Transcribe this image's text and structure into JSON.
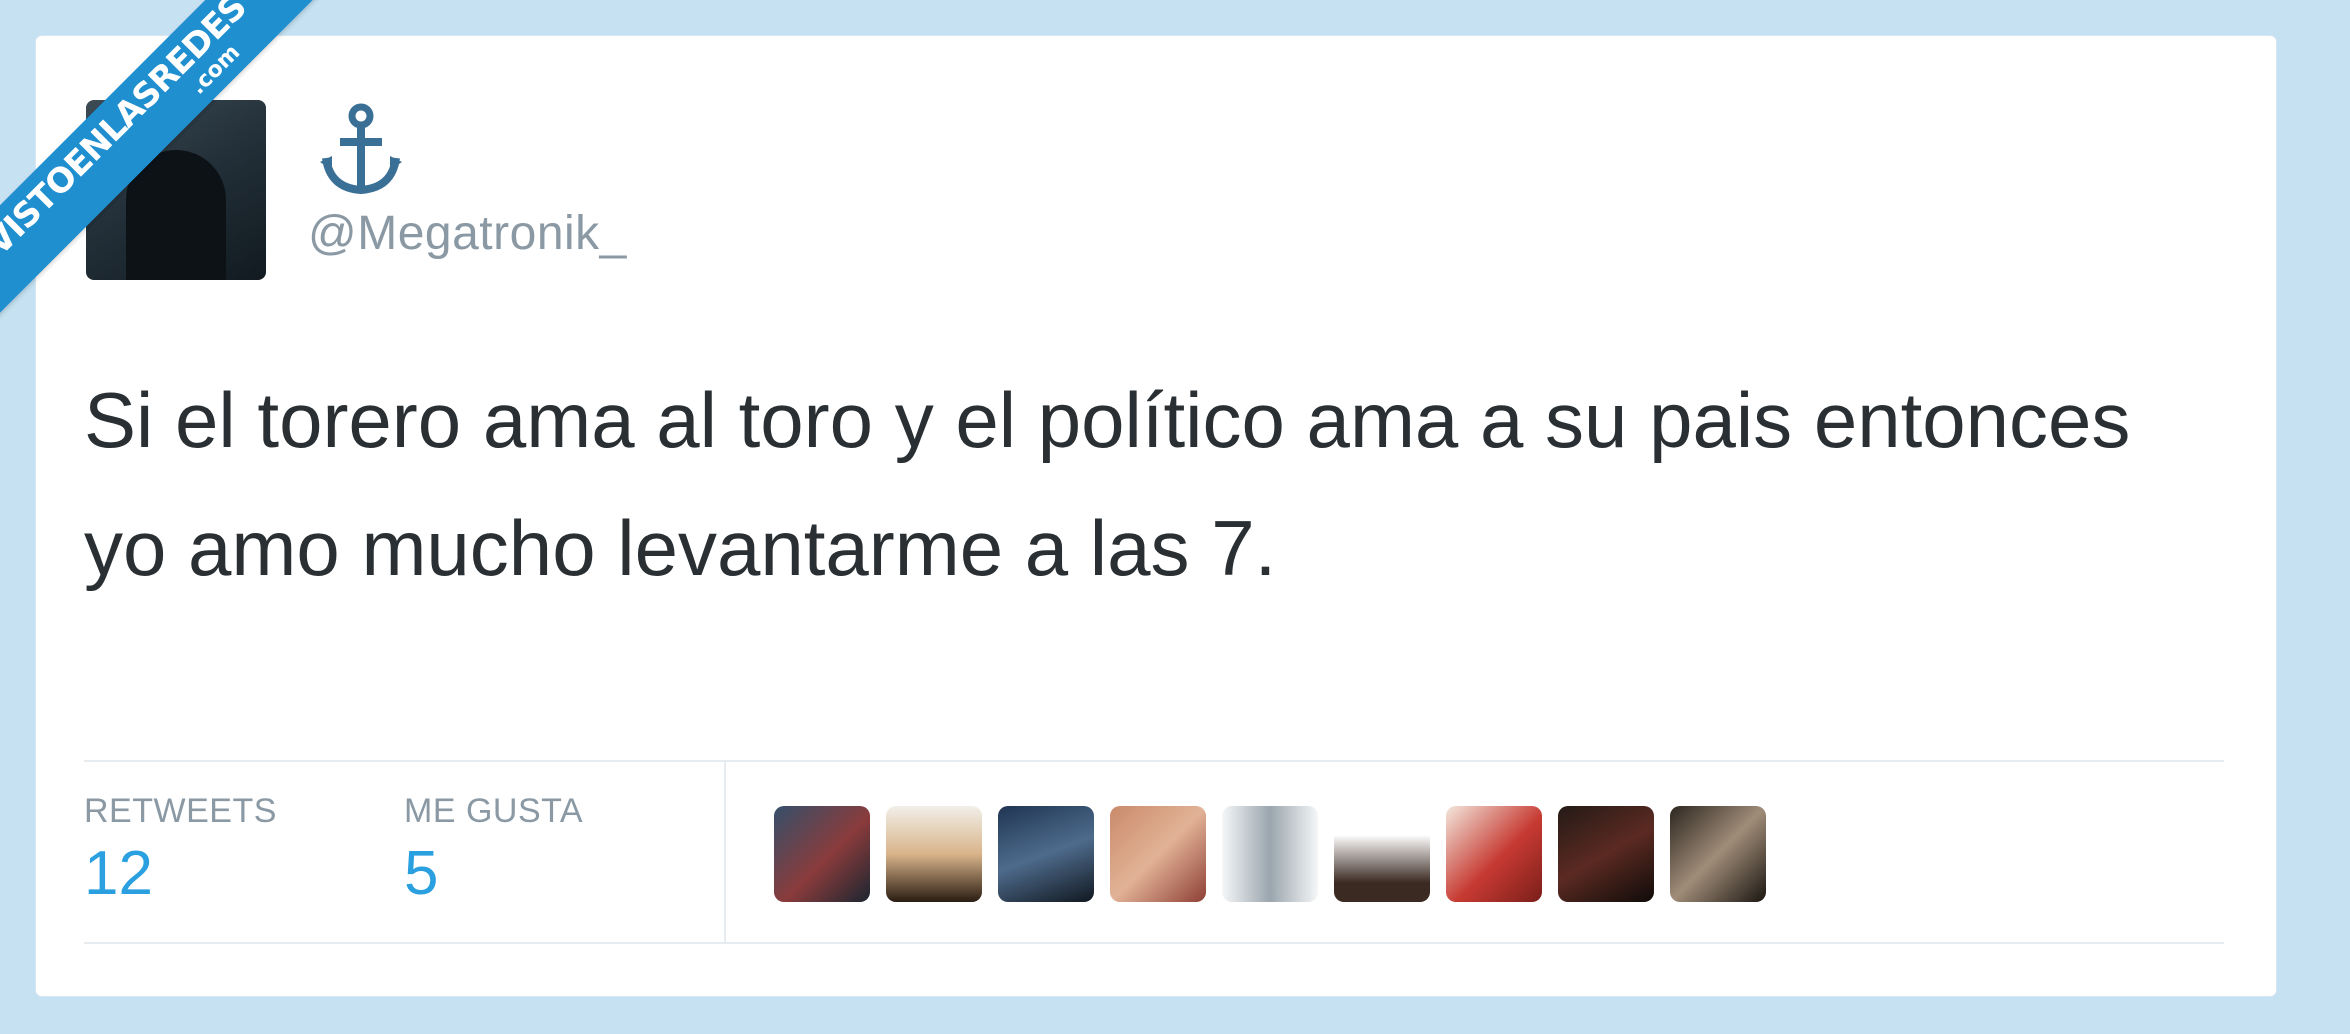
{
  "watermark": {
    "main": "VISTOENLASREDES",
    "sub": ".com"
  },
  "tweet": {
    "handle": "@Megatronik_",
    "display_name_icon": "anchor-icon",
    "text": "Si el torero ama al toro y el político ama a su pais entonces yo amo mucho levantarme a las 7."
  },
  "stats": {
    "retweets_label": "RETWEETS",
    "retweets_value": "12",
    "likes_label": "ME GUSTA",
    "likes_value": "5"
  },
  "likers": [
    {
      "icon": "liker-avatar-1"
    },
    {
      "icon": "liker-avatar-2"
    },
    {
      "icon": "liker-avatar-3"
    },
    {
      "icon": "liker-avatar-4"
    },
    {
      "icon": "liker-avatar-5"
    },
    {
      "icon": "liker-avatar-6"
    },
    {
      "icon": "liker-avatar-7"
    },
    {
      "icon": "liker-avatar-8"
    },
    {
      "icon": "liker-avatar-9"
    }
  ],
  "colors": {
    "background": "#c6e1f1",
    "card": "#ffffff",
    "text": "#292f33",
    "muted": "#8a99a4",
    "accent": "#2aa0e0",
    "watermark": "#1f8fd0"
  }
}
